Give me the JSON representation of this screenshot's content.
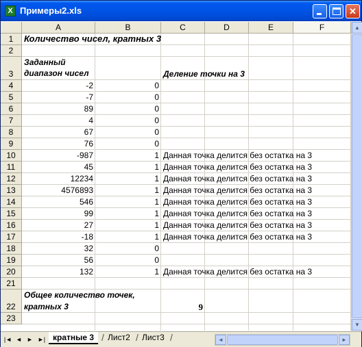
{
  "window": {
    "title": "Примеры2.xls",
    "icon_letter": "X",
    "controls": {
      "minimize": "minimize-icon",
      "maximize": "maximize-icon",
      "close": "✕"
    }
  },
  "columns": [
    "A",
    "B",
    "C",
    "D",
    "E",
    "F"
  ],
  "selected_column": "F",
  "rows": [
    "1",
    "2",
    "3",
    "4",
    "5",
    "6",
    "7",
    "8",
    "9",
    "10",
    "11",
    "12",
    "13",
    "14",
    "15",
    "16",
    "17",
    "18",
    "19",
    "20",
    "21",
    "22",
    "23"
  ],
  "header_title": "Количество чисел, кратных 3",
  "range_label_line1": "Заданный",
  "range_label_line2": "диапазон чисел",
  "division_label": "Деление точки на 3",
  "data_rows": [
    {
      "a": "-2",
      "b": "0",
      "c": ""
    },
    {
      "a": "-7",
      "b": "0",
      "c": ""
    },
    {
      "a": "89",
      "b": "0",
      "c": ""
    },
    {
      "a": "4",
      "b": "0",
      "c": ""
    },
    {
      "a": "67",
      "b": "0",
      "c": ""
    },
    {
      "a": "76",
      "b": "0",
      "c": ""
    },
    {
      "a": "-987",
      "b": "1",
      "c": "Данная точка делится без остатка на 3"
    },
    {
      "a": "45",
      "b": "1",
      "c": "Данная точка делится без остатка на 3"
    },
    {
      "a": "12234",
      "b": "1",
      "c": "Данная точка делится без остатка на 3"
    },
    {
      "a": "4576893",
      "b": "1",
      "c": "Данная точка делится без остатка на 3"
    },
    {
      "a": "546",
      "b": "1",
      "c": "Данная точка делится без остатка на 3"
    },
    {
      "a": "99",
      "b": "1",
      "c": "Данная точка делится без остатка на 3"
    },
    {
      "a": "27",
      "b": "1",
      "c": "Данная точка делится без остатка на 3"
    },
    {
      "a": "-18",
      "b": "1",
      "c": "Данная точка делится без остатка на 3"
    },
    {
      "a": "32",
      "b": "0",
      "c": ""
    },
    {
      "a": "56",
      "b": "0",
      "c": ""
    },
    {
      "a": "132",
      "b": "1",
      "c": "Данная точка делится без остатка на 3"
    }
  ],
  "total_label_line1": "Общее количество точек,",
  "total_label_line2": "кратных 3",
  "total_value": "9",
  "sheet_tabs": [
    "кратные 3",
    "Лист2",
    "Лист3"
  ],
  "active_tab": "кратные 3",
  "nav_buttons": [
    "|◄",
    "◄",
    "►",
    "►|"
  ]
}
